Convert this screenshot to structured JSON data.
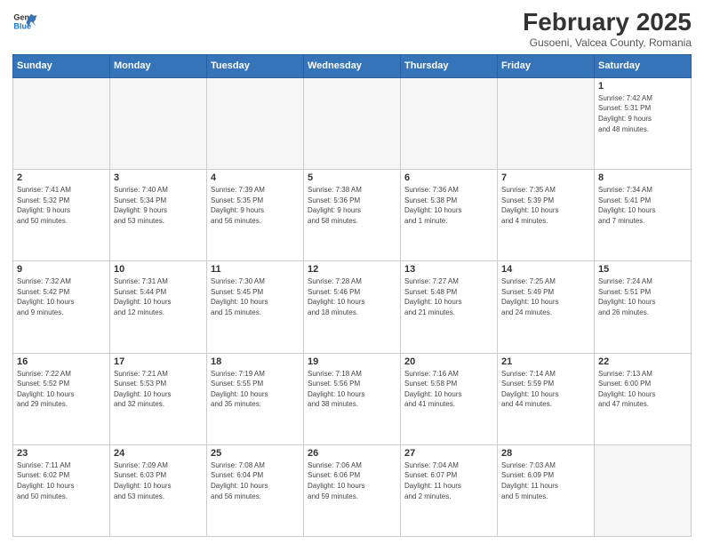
{
  "header": {
    "logo_line1": "General",
    "logo_line2": "Blue",
    "month_title": "February 2025",
    "subtitle": "Gusoeni, Valcea County, Romania"
  },
  "weekdays": [
    "Sunday",
    "Monday",
    "Tuesday",
    "Wednesday",
    "Thursday",
    "Friday",
    "Saturday"
  ],
  "weeks": [
    [
      {
        "day": "",
        "info": ""
      },
      {
        "day": "",
        "info": ""
      },
      {
        "day": "",
        "info": ""
      },
      {
        "day": "",
        "info": ""
      },
      {
        "day": "",
        "info": ""
      },
      {
        "day": "",
        "info": ""
      },
      {
        "day": "1",
        "info": "Sunrise: 7:42 AM\nSunset: 5:31 PM\nDaylight: 9 hours\nand 48 minutes."
      }
    ],
    [
      {
        "day": "2",
        "info": "Sunrise: 7:41 AM\nSunset: 5:32 PM\nDaylight: 9 hours\nand 50 minutes."
      },
      {
        "day": "3",
        "info": "Sunrise: 7:40 AM\nSunset: 5:34 PM\nDaylight: 9 hours\nand 53 minutes."
      },
      {
        "day": "4",
        "info": "Sunrise: 7:39 AM\nSunset: 5:35 PM\nDaylight: 9 hours\nand 56 minutes."
      },
      {
        "day": "5",
        "info": "Sunrise: 7:38 AM\nSunset: 5:36 PM\nDaylight: 9 hours\nand 58 minutes."
      },
      {
        "day": "6",
        "info": "Sunrise: 7:36 AM\nSunset: 5:38 PM\nDaylight: 10 hours\nand 1 minute."
      },
      {
        "day": "7",
        "info": "Sunrise: 7:35 AM\nSunset: 5:39 PM\nDaylight: 10 hours\nand 4 minutes."
      },
      {
        "day": "8",
        "info": "Sunrise: 7:34 AM\nSunset: 5:41 PM\nDaylight: 10 hours\nand 7 minutes."
      }
    ],
    [
      {
        "day": "9",
        "info": "Sunrise: 7:32 AM\nSunset: 5:42 PM\nDaylight: 10 hours\nand 9 minutes."
      },
      {
        "day": "10",
        "info": "Sunrise: 7:31 AM\nSunset: 5:44 PM\nDaylight: 10 hours\nand 12 minutes."
      },
      {
        "day": "11",
        "info": "Sunrise: 7:30 AM\nSunset: 5:45 PM\nDaylight: 10 hours\nand 15 minutes."
      },
      {
        "day": "12",
        "info": "Sunrise: 7:28 AM\nSunset: 5:46 PM\nDaylight: 10 hours\nand 18 minutes."
      },
      {
        "day": "13",
        "info": "Sunrise: 7:27 AM\nSunset: 5:48 PM\nDaylight: 10 hours\nand 21 minutes."
      },
      {
        "day": "14",
        "info": "Sunrise: 7:25 AM\nSunset: 5:49 PM\nDaylight: 10 hours\nand 24 minutes."
      },
      {
        "day": "15",
        "info": "Sunrise: 7:24 AM\nSunset: 5:51 PM\nDaylight: 10 hours\nand 26 minutes."
      }
    ],
    [
      {
        "day": "16",
        "info": "Sunrise: 7:22 AM\nSunset: 5:52 PM\nDaylight: 10 hours\nand 29 minutes."
      },
      {
        "day": "17",
        "info": "Sunrise: 7:21 AM\nSunset: 5:53 PM\nDaylight: 10 hours\nand 32 minutes."
      },
      {
        "day": "18",
        "info": "Sunrise: 7:19 AM\nSunset: 5:55 PM\nDaylight: 10 hours\nand 35 minutes."
      },
      {
        "day": "19",
        "info": "Sunrise: 7:18 AM\nSunset: 5:56 PM\nDaylight: 10 hours\nand 38 minutes."
      },
      {
        "day": "20",
        "info": "Sunrise: 7:16 AM\nSunset: 5:58 PM\nDaylight: 10 hours\nand 41 minutes."
      },
      {
        "day": "21",
        "info": "Sunrise: 7:14 AM\nSunset: 5:59 PM\nDaylight: 10 hours\nand 44 minutes."
      },
      {
        "day": "22",
        "info": "Sunrise: 7:13 AM\nSunset: 6:00 PM\nDaylight: 10 hours\nand 47 minutes."
      }
    ],
    [
      {
        "day": "23",
        "info": "Sunrise: 7:11 AM\nSunset: 6:02 PM\nDaylight: 10 hours\nand 50 minutes."
      },
      {
        "day": "24",
        "info": "Sunrise: 7:09 AM\nSunset: 6:03 PM\nDaylight: 10 hours\nand 53 minutes."
      },
      {
        "day": "25",
        "info": "Sunrise: 7:08 AM\nSunset: 6:04 PM\nDaylight: 10 hours\nand 56 minutes."
      },
      {
        "day": "26",
        "info": "Sunrise: 7:06 AM\nSunset: 6:06 PM\nDaylight: 10 hours\nand 59 minutes."
      },
      {
        "day": "27",
        "info": "Sunrise: 7:04 AM\nSunset: 6:07 PM\nDaylight: 11 hours\nand 2 minutes."
      },
      {
        "day": "28",
        "info": "Sunrise: 7:03 AM\nSunset: 6:09 PM\nDaylight: 11 hours\nand 5 minutes."
      },
      {
        "day": "",
        "info": ""
      }
    ]
  ]
}
